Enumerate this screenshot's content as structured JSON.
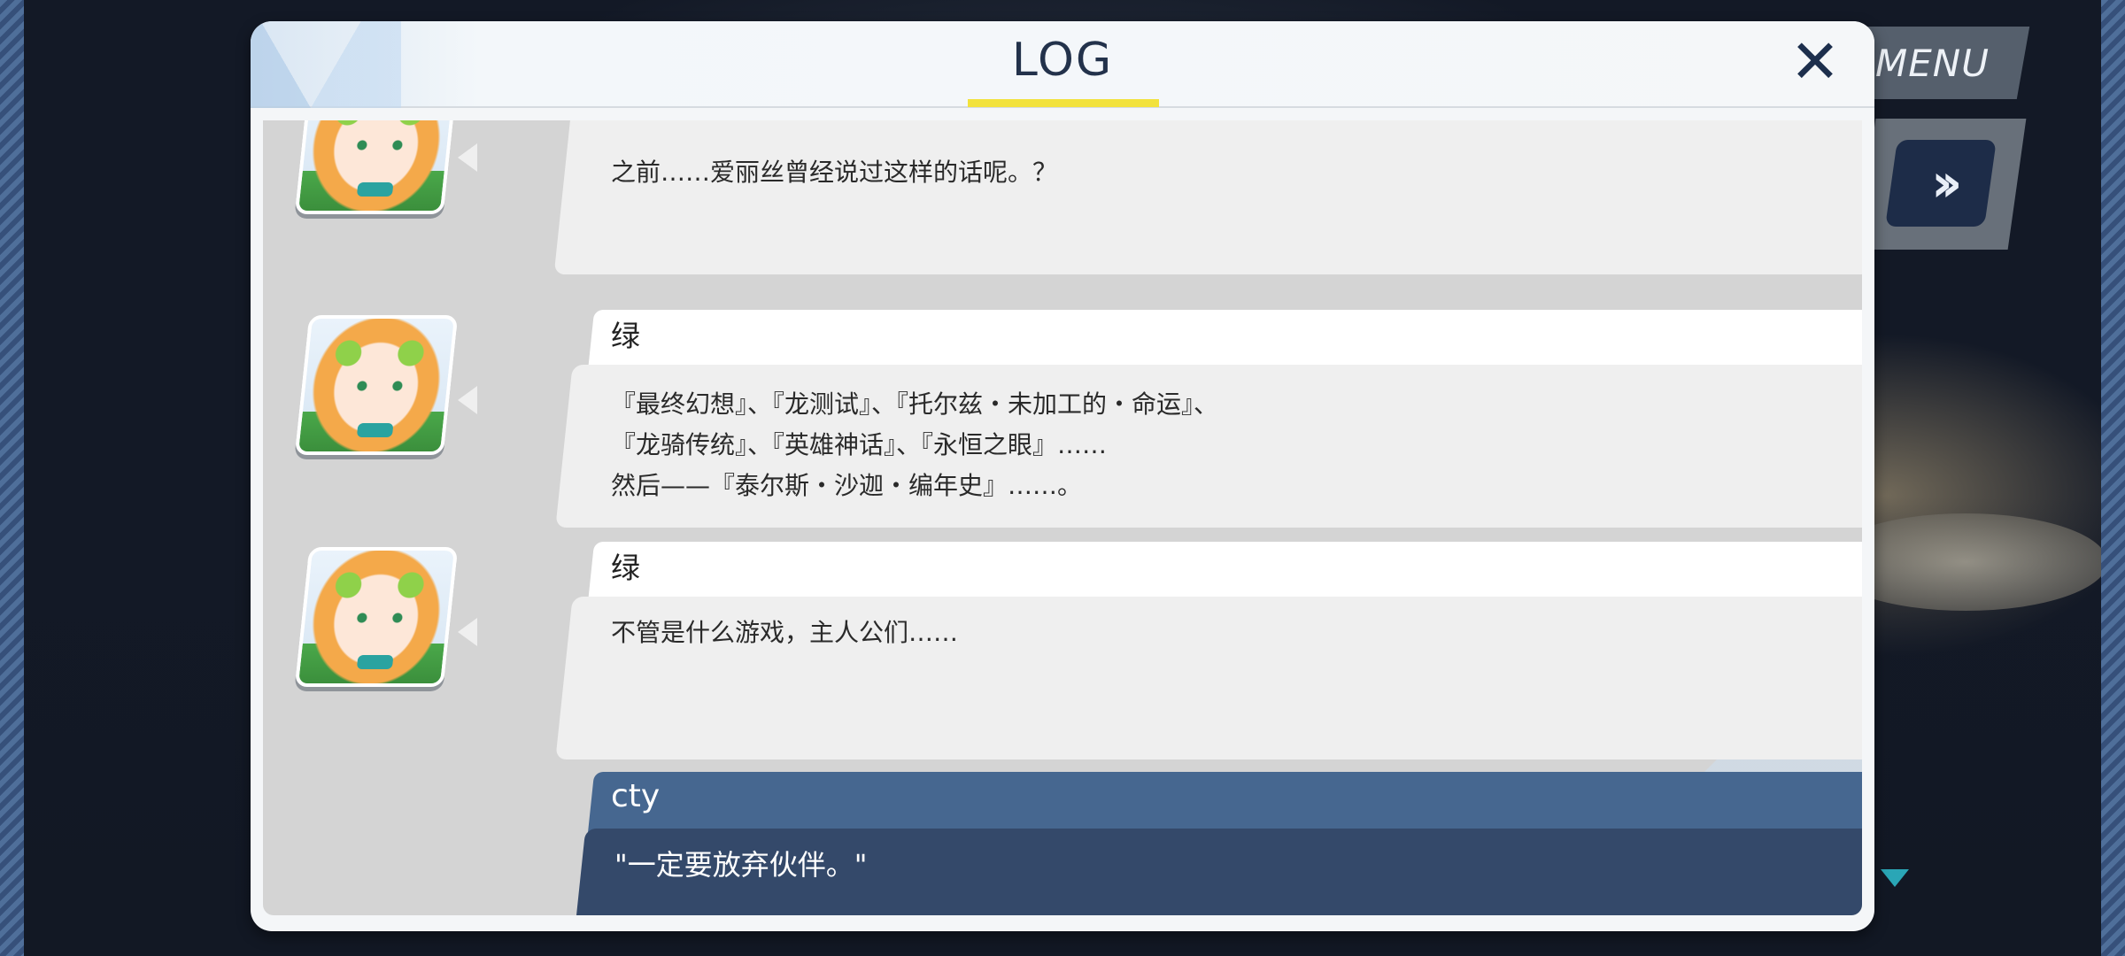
{
  "hud": {
    "menu_label": "MENU",
    "skip_icon": "double-chevron-right-icon",
    "scroll_icon": "triangle-down-icon"
  },
  "log": {
    "title": "LOG",
    "close_icon": "close-x-icon",
    "entries": [
      {
        "speaker": "",
        "lines": [
          "之前……爱丽丝曾经说过这样的话呢。？"
        ]
      },
      {
        "speaker": "绿",
        "lines": [
          "『最终幻想』、『龙测试』、『托尔兹・未加工的・命运』、",
          "『龙骑传统』、『英雄神话』、『永恒之眼』……",
          "然后——『泰尔斯・沙迦・编年史』……。"
        ]
      },
      {
        "speaker": "绿",
        "lines": [
          "不管是什么游戏，主人公们……"
        ]
      }
    ],
    "player": {
      "speaker": "cty",
      "line": "\"一定要放弃伙伴。\""
    }
  },
  "colors": {
    "player_accent": "#466790",
    "player_bg": "#34496a",
    "title_underline": "#f2e23c"
  }
}
